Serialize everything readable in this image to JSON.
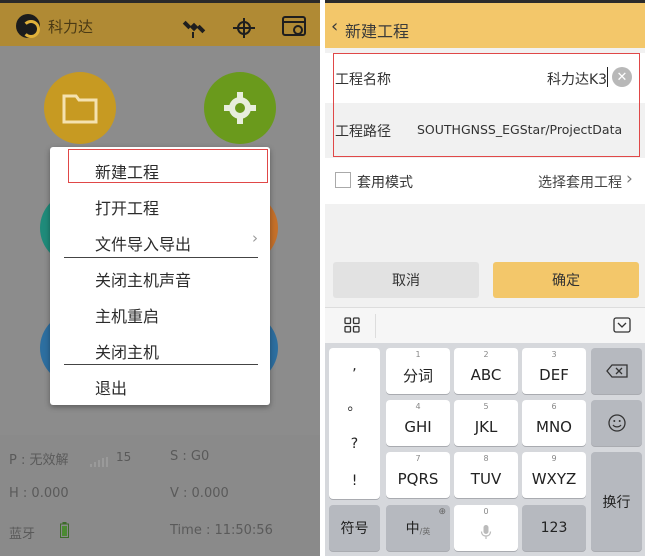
{
  "left": {
    "app_title": "科力达",
    "menu": {
      "items": [
        "新建工程",
        "打开工程",
        "文件导入导出",
        "关闭主机声音",
        "主机重启",
        "关闭主机",
        "退出"
      ]
    },
    "status": {
      "p": "P : 无效解",
      "sat_count": "15",
      "s": "S : G0",
      "h": "H : 0.000",
      "v": "V : 0.000",
      "bluetooth": "蓝牙",
      "time": "Time :  11:50:56"
    },
    "colors": {
      "folder": "#c79a22",
      "settings": "#6a9a1c",
      "topbar": "#b08a34"
    }
  },
  "right": {
    "header_title": "新建工程",
    "project_name_label": "工程名称",
    "project_name_value": "科力达K3",
    "project_path_label": "工程路径",
    "project_path_value": "SOUTHGNSS_EGStar/ProjectData",
    "template_mode_label": "套用模式",
    "select_template": "选择套用工程",
    "cancel": "取消",
    "confirm": "确定",
    "keyboard": {
      "punct": [
        ",",
        "。",
        "?",
        "!"
      ],
      "row1": [
        {
          "n": "1",
          "l": "分词"
        },
        {
          "n": "2",
          "l": "ABC"
        },
        {
          "n": "3",
          "l": "DEF"
        }
      ],
      "row2": [
        {
          "n": "4",
          "l": "GHI"
        },
        {
          "n": "5",
          "l": "JKL"
        },
        {
          "n": "6",
          "l": "MNO"
        }
      ],
      "row3": [
        {
          "n": "7",
          "l": "PQRS"
        },
        {
          "n": "8",
          "l": "TUV"
        },
        {
          "n": "9",
          "l": "WXYZ"
        }
      ],
      "symbol": "符号",
      "lang": "中",
      "lang_sub": "/英",
      "space_num": "0",
      "num": "123",
      "newline": "换行"
    },
    "colors": {
      "header": "#f3c76a",
      "confirm": "#f3c76a"
    }
  }
}
